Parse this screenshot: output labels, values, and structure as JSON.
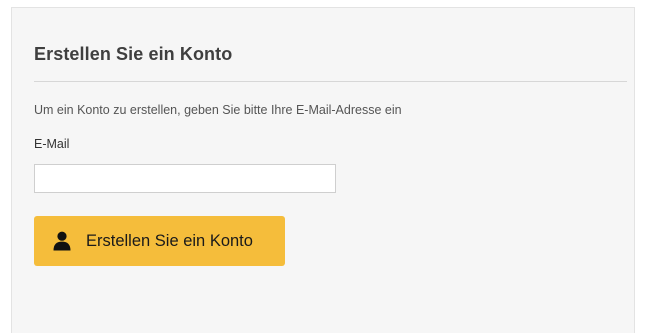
{
  "form": {
    "title": "Erstellen Sie ein Konto",
    "intro": "Um ein Konto zu erstellen, geben Sie bitte Ihre E-Mail-Adresse ein",
    "email_label": "E-Mail",
    "email_value": "",
    "email_placeholder": "",
    "submit_label": "Erstellen Sie ein Konto",
    "submit_icon": "user-icon"
  },
  "colors": {
    "button_background": "#f5bd3b",
    "panel_background": "#f6f6f6",
    "title_text": "#3f3f3f"
  }
}
